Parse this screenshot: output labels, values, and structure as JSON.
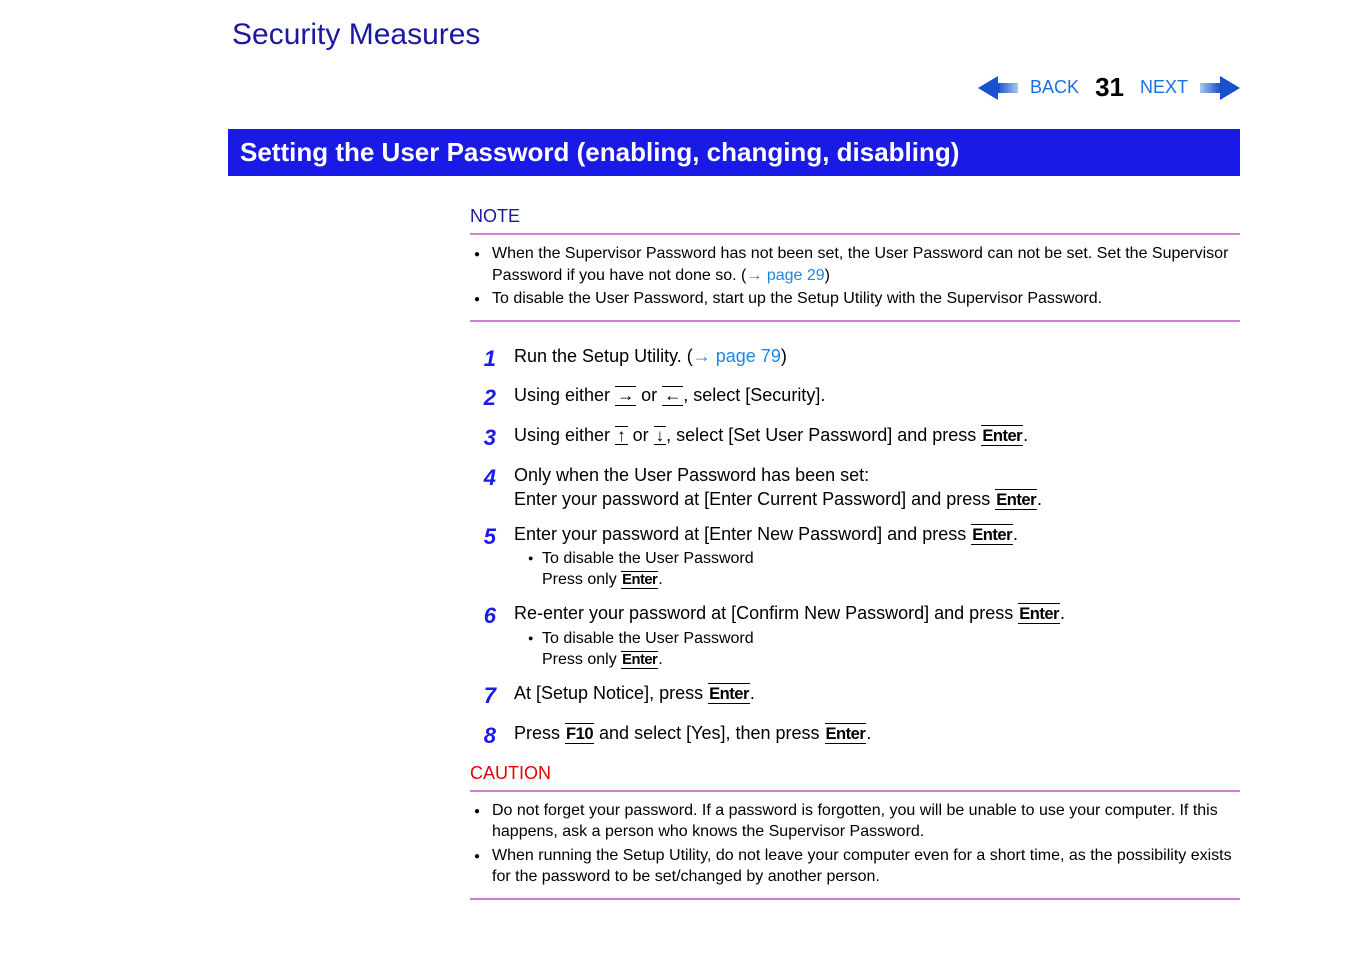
{
  "header": {
    "title": "Security Measures",
    "back_label": "BACK",
    "next_label": "NEXT",
    "page_number": "31"
  },
  "section": {
    "heading": "Setting the User Password (enabling, changing, disabling)"
  },
  "note": {
    "label": "NOTE",
    "items": [
      {
        "text_a": "When the Supervisor Password has not been set, the User Password can not be set. Set the Supervisor Password if you have not done so. (",
        "link": "page 29",
        "text_b": ")"
      },
      {
        "text": "To disable the User Password, start up the Setup Utility with the Supervisor Password."
      }
    ]
  },
  "steps": {
    "s1": {
      "num": "1",
      "a": "Run the Setup Utility. (",
      "link": "page 79",
      "b": ")"
    },
    "s2": {
      "num": "2",
      "a": "Using either ",
      "b": " or ",
      "c": ", select [Security]."
    },
    "s3": {
      "num": "3",
      "a": "Using either ",
      "b": " or ",
      "c": ", select [Set User Password] and press ",
      "key": "Enter",
      "d": "."
    },
    "s4": {
      "num": "4",
      "line1": "Only when the User Password has been set:",
      "line2a": "Enter your password at [Enter Current Password] and press ",
      "key": "Enter",
      "line2b": "."
    },
    "s5": {
      "num": "5",
      "a": "Enter your password at [Enter New Password] and press ",
      "key": "Enter",
      "b": ".",
      "sub1": "To disable the User Password",
      "sub2a": "Press only ",
      "sub2key": "Enter",
      "sub2b": "."
    },
    "s6": {
      "num": "6",
      "a": "Re-enter your password at [Confirm New Password] and press ",
      "key": "Enter",
      "b": ".",
      "sub1": "To disable the User Password",
      "sub2a": "Press only ",
      "sub2key": "Enter",
      "sub2b": "."
    },
    "s7": {
      "num": "7",
      "a": "At [Setup Notice], press ",
      "key": "Enter",
      "b": "."
    },
    "s8": {
      "num": "8",
      "a": "Press ",
      "key1": "F10",
      "b": " and select [Yes], then press ",
      "key2": "Enter",
      "c": "."
    }
  },
  "caution": {
    "label": "CAUTION",
    "items": [
      "Do not forget your password.  If a password is forgotten, you will be unable to use your computer. If this happens, ask a person who knows the Supervisor Password.",
      "When running the Setup Utility, do not leave your computer even for a short time, as the possibility exists for the password to be set/changed by another person."
    ]
  },
  "glyphs": {
    "right": "→",
    "left": "←",
    "up": "↑",
    "down": "↓",
    "link_arrow": "→"
  }
}
